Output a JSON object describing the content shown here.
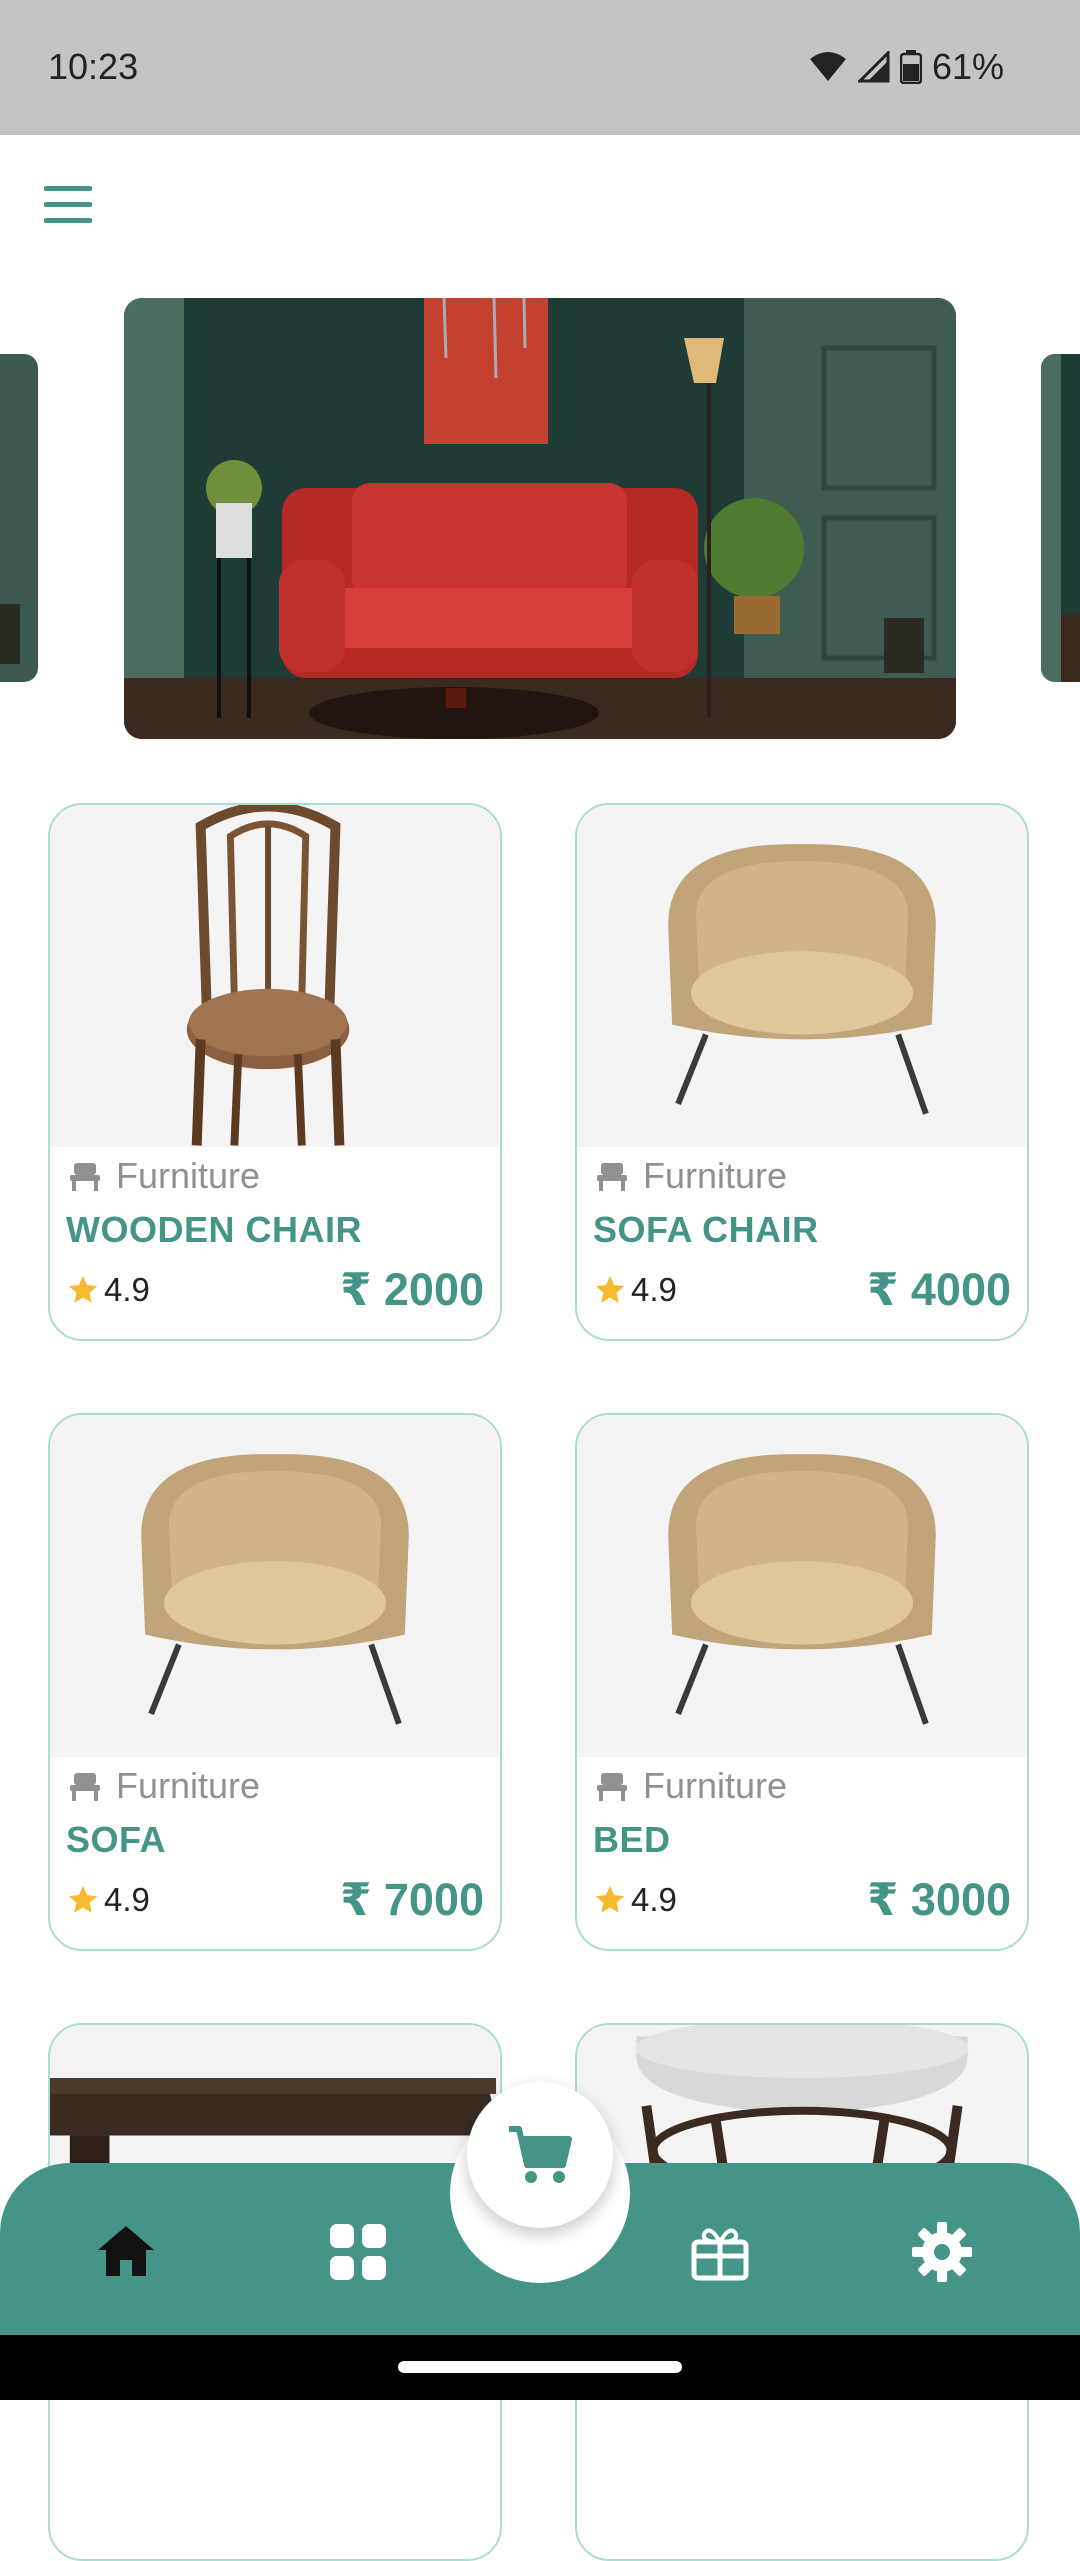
{
  "status_bar": {
    "time": "10:23",
    "battery": "61%"
  },
  "header": {
    "menu_icon": "hamburger-menu-icon"
  },
  "banner": {
    "image": "red sofa living room"
  },
  "products": [
    {
      "category": "Furniture",
      "name": "WOODEN CHAIR",
      "rating": "4.9",
      "price": "₹ 2000",
      "image": "wooden-chair"
    },
    {
      "category": "Furniture",
      "name": "SOFA CHAIR",
      "rating": "4.9",
      "price": "₹ 4000",
      "image": "sofa-chair"
    },
    {
      "category": "Furniture",
      "name": "SOFA",
      "rating": "4.9",
      "price": "₹ 7000",
      "image": "sofa-chair"
    },
    {
      "category": "Furniture",
      "name": "BED",
      "rating": "4.9",
      "price": "₹ 3000",
      "image": "sofa-chair"
    },
    {
      "image": "wooden-table"
    },
    {
      "image": "marble-side-table"
    }
  ],
  "bottom_nav": {
    "items": [
      "home-icon",
      "grid-icon",
      "cart-icon",
      "gift-icon",
      "settings-icon"
    ],
    "active": "home-icon"
  },
  "colors": {
    "accent": "#449488",
    "card_border": "#a9ddd4",
    "star": "#f5b82e",
    "status_bar": "#c4c4c4"
  }
}
